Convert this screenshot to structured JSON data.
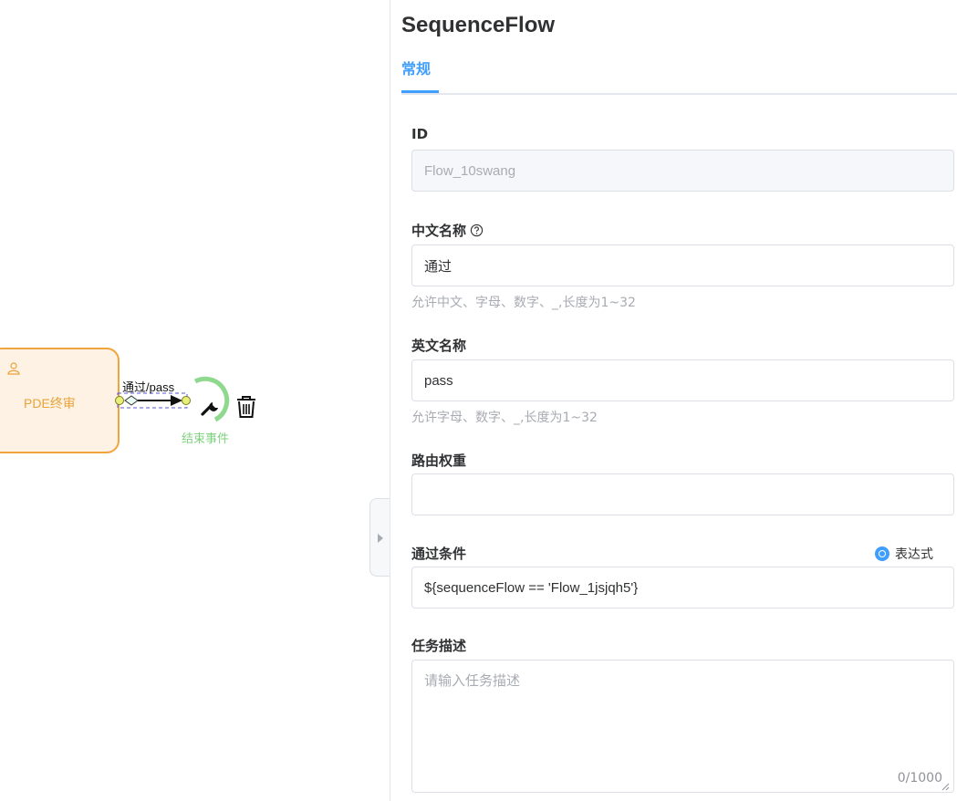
{
  "canvas": {
    "task_label": "PDE终审",
    "flow_label": "通过/pass",
    "end_event_label": "结束事件",
    "colors": {
      "task_border": "#f0a53c",
      "task_fill": "#fdf2e3",
      "end_event": "#7fd17f"
    }
  },
  "panel": {
    "title": "SequenceFlow",
    "tabs": [
      {
        "label": "常规"
      }
    ],
    "fields": {
      "id": {
        "label": "ID",
        "value": "Flow_10swang"
      },
      "cn_name": {
        "label": "中文名称",
        "value": "通过",
        "hint": "允许中文、字母、数字、_,长度为1~32"
      },
      "en_name": {
        "label": "英文名称",
        "value": "pass",
        "hint": "允许字母、数字、_,长度为1~32"
      },
      "route_weight": {
        "label": "路由权重",
        "value": ""
      },
      "pass_condition": {
        "label": "通过条件",
        "radio_label": "表达式",
        "value": "${sequenceFlow == 'Flow_1jsjqh5'}"
      },
      "task_desc": {
        "label": "任务描述",
        "placeholder": "请输入任务描述",
        "counter": "0/1000"
      }
    },
    "accent_color": "#409eff"
  }
}
